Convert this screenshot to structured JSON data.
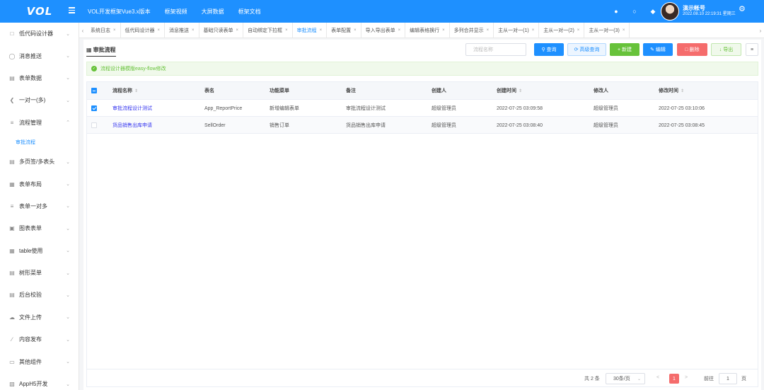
{
  "header": {
    "logo": "VOL",
    "nav": [
      "VOL开发框架Vue3.x版本",
      "框架视频",
      "大屏数据",
      "框架文档"
    ],
    "icons": [
      "user-icon",
      "circle-icon",
      "bell-icon"
    ],
    "user_name": "演示帐号",
    "datetime": "2022.08.10 22:19:31 星期三",
    "brand_color": "#1e90ff"
  },
  "sidebar": {
    "items": [
      {
        "label": "低代码设计器",
        "icon": "form-icon"
      },
      {
        "label": "消息推送",
        "icon": "message-icon"
      },
      {
        "label": "表单数据",
        "icon": "table-icon"
      },
      {
        "label": "一对一(多)",
        "icon": "share-icon"
      },
      {
        "label": "流程管理",
        "icon": "sliders-icon",
        "expanded": true
      },
      {
        "label": "多页签/多表头",
        "icon": "tabs-icon"
      },
      {
        "label": "表单布局",
        "icon": "layout-icon"
      },
      {
        "label": "表单一对多",
        "icon": "sliders-icon"
      },
      {
        "label": "图表表单",
        "icon": "chart-icon"
      },
      {
        "label": "table使用",
        "icon": "grid-icon"
      },
      {
        "label": "树形菜单",
        "icon": "tree-icon"
      },
      {
        "label": "后台校验",
        "icon": "check-icon"
      },
      {
        "label": "文件上传",
        "icon": "upload-icon"
      },
      {
        "label": "内容发布",
        "icon": "edit-icon"
      },
      {
        "label": "其他组件",
        "icon": "folder-icon"
      },
      {
        "label": "AppH5开发",
        "icon": "apps-icon"
      }
    ],
    "sub_item": "审批流程"
  },
  "tabs": [
    {
      "label": "系统日志",
      "active": false
    },
    {
      "label": "低代码设计器",
      "active": false
    },
    {
      "label": "消息推送",
      "active": false
    },
    {
      "label": "基础只读表单",
      "active": false
    },
    {
      "label": "自动绑定下拉框",
      "active": false
    },
    {
      "label": "审批流程",
      "active": true
    },
    {
      "label": "表单配置",
      "active": false
    },
    {
      "label": "导入导出表单",
      "active": false
    },
    {
      "label": "编辑表格换行",
      "active": false
    },
    {
      "label": "多列合并显示",
      "active": false
    },
    {
      "label": "主从一对一(1)",
      "active": false
    },
    {
      "label": "主从一对一(2)",
      "active": false
    },
    {
      "label": "主从一对一(3)",
      "active": false
    }
  ],
  "page": {
    "title": "审批流程",
    "search_placeholder": "流程名称",
    "buttons": {
      "query": "查询",
      "advanced": "高级查询",
      "new": "新建",
      "edit": "编辑",
      "delete": "删除",
      "export": "导出"
    },
    "alert": "流程设计器模版easy-flow修改"
  },
  "table": {
    "columns": [
      "流程名称",
      "表名",
      "功能菜单",
      "备注",
      "创建人",
      "创建时间",
      "修改人",
      "修改时间"
    ],
    "rows": [
      {
        "checked": true,
        "name": "审批流程设计测试",
        "table": "App_ReportPrice",
        "menu": "新增编辑表单",
        "remark": "审批流程设计测试",
        "creator": "超级管理员",
        "created": "2022-07-25 03:09:58",
        "modifier": "超级管理员",
        "modified": "2022-07-25 03:10:06"
      },
      {
        "checked": false,
        "name": "货品销售出库申请",
        "table": "SellOrder",
        "menu": "销售订单",
        "remark": "货品销售出库申请",
        "creator": "超级管理员",
        "created": "2022-07-25 03:08:40",
        "modifier": "超级管理员",
        "modified": "2022-07-25 03:08:45"
      }
    ]
  },
  "pager": {
    "total": "共 2 条",
    "page_size": "30条/页",
    "current_page": "1",
    "goto_label": "前往",
    "goto_value": "1",
    "page_suffix": "页"
  }
}
